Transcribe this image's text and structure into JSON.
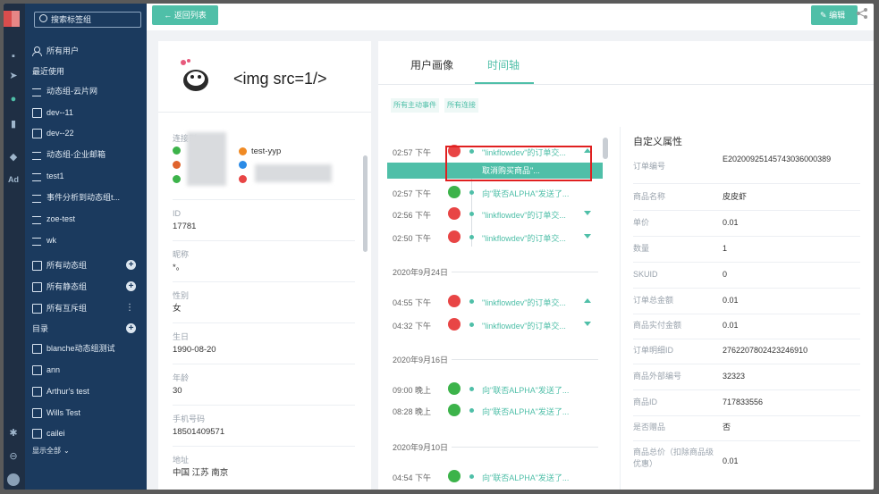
{
  "sidebar": {
    "search_placeholder": "搜索标签组",
    "items": [
      {
        "label": "所有用户",
        "icon": "user-group-icon"
      },
      {
        "label": "最近使用",
        "icon": ""
      },
      {
        "label": "动态组-云片网",
        "icon": "sync-icon"
      },
      {
        "label": "dev--11",
        "icon": "static-group-icon"
      },
      {
        "label": "dev--22",
        "icon": "static-group-icon"
      },
      {
        "label": "动态组-企业邮箱",
        "icon": "sync-icon"
      },
      {
        "label": "test1",
        "icon": "sync-icon"
      },
      {
        "label": "事件分析到动态组t...",
        "icon": "sync-icon"
      },
      {
        "label": "zoe-test",
        "icon": "sync-icon"
      },
      {
        "label": "wk",
        "icon": "sync-icon"
      },
      {
        "label": "所有动态组",
        "icon": "folder-icon"
      },
      {
        "label": "所有静态组",
        "icon": "folder-icon"
      },
      {
        "label": "所有互斥组",
        "icon": "folder-icon"
      },
      {
        "label": "目录",
        "icon": ""
      },
      {
        "label": "blanche动态组测试",
        "icon": "folder-icon"
      },
      {
        "label": "ann",
        "icon": "folder-icon"
      },
      {
        "label": "Arthur's test",
        "icon": "folder-icon"
      },
      {
        "label": "Wills Test",
        "icon": "folder-icon"
      },
      {
        "label": "cailei",
        "icon": "folder-icon"
      }
    ],
    "show_all": "显示全部"
  },
  "rail": {
    "ad_label": "Ad"
  },
  "topbar": {
    "back_label": "返回列表",
    "edit_label": "编辑"
  },
  "profile": {
    "title": "<img src=1/>",
    "connections_label": "连接到",
    "connection_tag": "test-yyp",
    "fields": [
      {
        "label": "ID",
        "value": "17781"
      },
      {
        "label": "昵称",
        "value": "*。"
      },
      {
        "label": "性别",
        "value": "女"
      },
      {
        "label": "生日",
        "value": "1990-08-20"
      },
      {
        "label": "年龄",
        "value": "30"
      },
      {
        "label": "手机号码",
        "value": "18501409571"
      },
      {
        "label": "地址",
        "value": "中国 江苏 南京"
      }
    ]
  },
  "main": {
    "tabs": [
      {
        "label": "用户画像"
      },
      {
        "label": "时间轴"
      }
    ],
    "active_tab": "时间轴",
    "filters": [
      "所有主动事件",
      "所有连接"
    ],
    "highlight_text": "取消购买商品\"...",
    "timeline": [
      {
        "time": "02:57 下午",
        "text": "\"linkflowdev\"的订单交...",
        "kind": "order"
      },
      {
        "time": "02:57 下午",
        "text": "向\"联否ALPHA\"发送了...",
        "kind": "wechat"
      },
      {
        "time": "02:56 下午",
        "text": "\"linkflowdev\"的订单交...",
        "kind": "order"
      },
      {
        "time": "02:50 下午",
        "text": "\"linkflowdev\"的订单交...",
        "kind": "order"
      },
      {
        "date": "2020年9月24日"
      },
      {
        "time": "04:55 下午",
        "text": "\"linkflowdev\"的订单交...",
        "kind": "order"
      },
      {
        "time": "04:32 下午",
        "text": "\"linkflowdev\"的订单交...",
        "kind": "order"
      },
      {
        "date": "2020年9月16日"
      },
      {
        "time": "09:00 晚上",
        "text": "向\"联否ALPHA\"发送了...",
        "kind": "wechat"
      },
      {
        "time": "08:28 晚上",
        "text": "向\"联否ALPHA\"发送了...",
        "kind": "wechat"
      },
      {
        "date": "2020年9月10日"
      },
      {
        "time": "04:54 下午",
        "text": "向\"联否ALPHA\"发送了...",
        "kind": "wechat"
      }
    ],
    "attrs_title": "自定义属性",
    "attrs": [
      {
        "key": "订单编号",
        "value": "E20200925145743036000389"
      },
      {
        "key": "商品名称",
        "value": "皮皮虾"
      },
      {
        "key": "单价",
        "value": "0.01"
      },
      {
        "key": "数量",
        "value": "1"
      },
      {
        "key": "SKUID",
        "value": "0"
      },
      {
        "key": "订单总金额",
        "value": "0.01"
      },
      {
        "key": "商品实付金额",
        "value": "0.01"
      },
      {
        "key": "订单明细ID",
        "value": "2762207802423246910"
      },
      {
        "key": "商品外部编号",
        "value": "32323"
      },
      {
        "key": "商品ID",
        "value": "717833556"
      },
      {
        "key": "是否赠品",
        "value": "否"
      },
      {
        "key": "商品总价（扣除商品级优惠）",
        "value": "0.01"
      }
    ]
  },
  "colors": {
    "accent": "#4fbfa8",
    "sidebar": "#1b3a5e",
    "rail": "#1f2f44",
    "order_badge": "#e84545",
    "wechat_badge": "#3cb34a",
    "highlight_border": "#e02020"
  }
}
